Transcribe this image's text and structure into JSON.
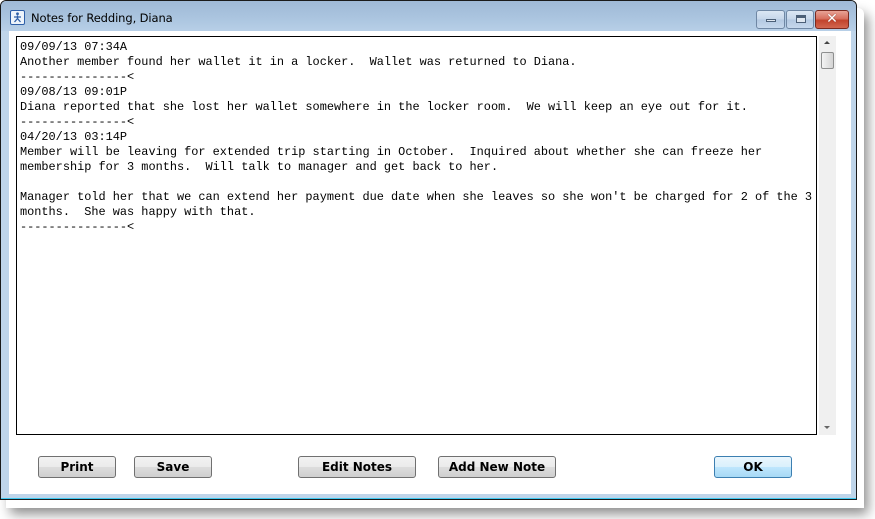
{
  "window": {
    "title": "Notes for Redding, Diana",
    "app_icon": "person-icon",
    "controls": {
      "minimize": "minimize-icon",
      "maximize": "maximize-icon",
      "close": "close-icon",
      "close_glyph": "✕"
    }
  },
  "notes": {
    "text": "09/09/13 07:34A\nAnother member found her wallet it in a locker.  Wallet was returned to Diana.\n---------------<\n09/08/13 09:01P\nDiana reported that she lost her wallet somewhere in the locker room.  We will keep an eye out for it.\n---------------<\n04/20/13 03:14P\nMember will be leaving for extended trip starting in October.  Inquired about whether she can freeze her\nmembership for 3 months.  Will talk to manager and get back to her.\n\nManager told her that we can extend her payment due date when she leaves so she won't be charged for 2 of the 3\nmonths.  She was happy with that.\n---------------<",
    "entries": [
      {
        "timestamp": "09/09/13 07:34A",
        "body": "Another member found her wallet it in a locker.  Wallet was returned to Diana."
      },
      {
        "timestamp": "09/08/13 09:01P",
        "body": "Diana reported that she lost her wallet somewhere in the locker room.  We will keep an eye out for it."
      },
      {
        "timestamp": "04/20/13 03:14P",
        "body": "Member will be leaving for extended trip starting in October.  Inquired about whether she can freeze her membership for 3 months.  Will talk to manager and get back to her.\n\nManager told her that we can extend her payment due date when she leaves so she won't be charged for 2 of the 3 months.  She was happy with that."
      }
    ],
    "separator": "---------------<"
  },
  "buttons": {
    "print": "Print",
    "save": "Save",
    "edit_notes": "Edit Notes",
    "add_new_note": "Add New Note",
    "ok": "OK"
  }
}
